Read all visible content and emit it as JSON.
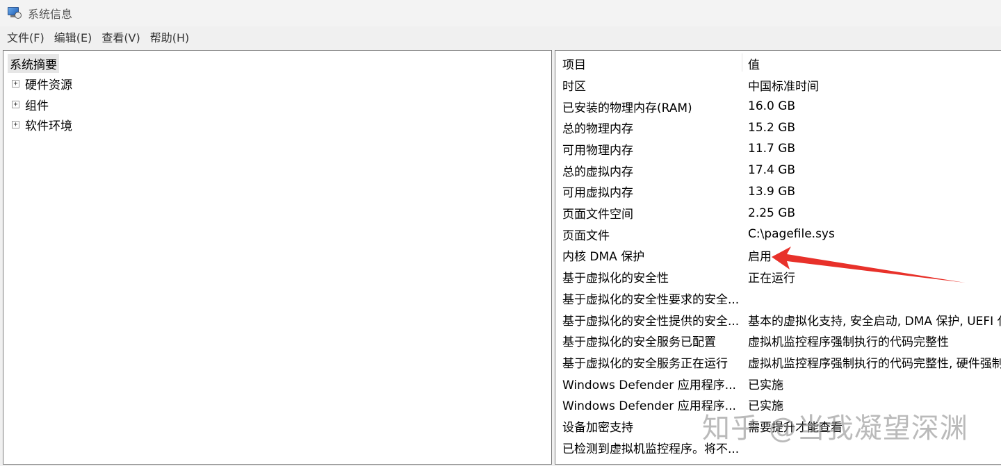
{
  "window": {
    "title": "系统信息",
    "icon": "system-info-icon"
  },
  "menu": [
    "文件(F)",
    "编辑(E)",
    "查看(V)",
    "帮助(H)"
  ],
  "tree": {
    "root": "系统摘要",
    "children": [
      "硬件资源",
      "组件",
      "软件环境"
    ],
    "expander": "+"
  },
  "table": {
    "headers": [
      "项目",
      "值"
    ],
    "rows": [
      [
        "时区",
        "中国标准时间"
      ],
      [
        "已安装的物理内存(RAM)",
        "16.0 GB"
      ],
      [
        "总的物理内存",
        "15.2 GB"
      ],
      [
        "可用物理内存",
        "11.7 GB"
      ],
      [
        "总的虚拟内存",
        "17.4 GB"
      ],
      [
        "可用虚拟内存",
        "13.9 GB"
      ],
      [
        "页面文件空间",
        "2.25 GB"
      ],
      [
        "页面文件",
        "C:\\pagefile.sys"
      ],
      [
        "内核 DMA 保护",
        "启用"
      ],
      [
        "基于虚拟化的安全性",
        "正在运行"
      ],
      [
        "基于虚拟化的安全性要求的安全...",
        ""
      ],
      [
        "基于虚拟化的安全性提供的安全...",
        "基本的虚拟化支持, 安全启动, DMA 保护, UEFI 代"
      ],
      [
        "基于虚拟化的安全服务已配置",
        "虚拟机监控程序强制执行的代码完整性"
      ],
      [
        "基于虚拟化的安全服务正在运行",
        "虚拟机监控程序强制执行的代码完整性, 硬件强制"
      ],
      [
        "Windows Defender 应用程序...",
        "已实施"
      ],
      [
        "Windows Defender 应用程序...",
        "已实施"
      ],
      [
        "设备加密支持",
        "需要提升才能查看"
      ],
      [
        "已检测到虚拟机监控程序。将不...",
        ""
      ]
    ]
  },
  "annotation": {
    "arrow_color": "#e8312a"
  },
  "watermark": "知乎 @当我凝望深渊"
}
